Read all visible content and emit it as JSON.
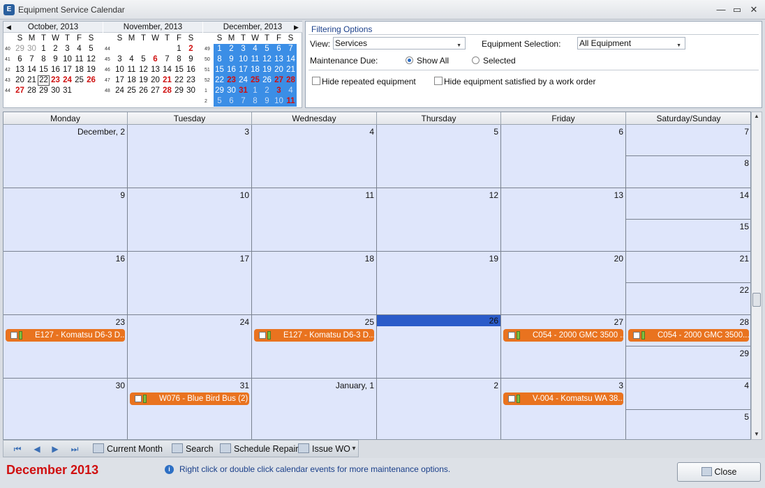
{
  "window": {
    "title": "Equipment Service Calendar",
    "min": "—",
    "max": "▭",
    "close": "✕"
  },
  "minical": {
    "nav_prev": "◀",
    "nav_next": "▶",
    "dow": [
      "S",
      "M",
      "T",
      "W",
      "T",
      "F",
      "S"
    ],
    "months": [
      {
        "title": "October, 2013",
        "weeks": [
          "40",
          "41",
          "42",
          "43",
          "44"
        ],
        "rows": [
          [
            "29g",
            "30g",
            "1",
            "2",
            "3",
            "4",
            "5"
          ],
          [
            "6",
            "7",
            "8",
            "9",
            "10",
            "11",
            "12"
          ],
          [
            "13",
            "14",
            "15",
            "16",
            "17",
            "18",
            "19"
          ],
          [
            "20",
            "21",
            "22t",
            "23r",
            "24r",
            "25",
            "26r"
          ],
          [
            "27r",
            "28",
            "29",
            "30",
            "31",
            "",
            ""
          ]
        ]
      },
      {
        "title": "November, 2013",
        "weeks": [
          "44",
          "45",
          "46",
          "47",
          "48"
        ],
        "rows": [
          [
            "",
            "",
            "",
            "",
            "",
            "1",
            "2r"
          ],
          [
            "3",
            "4",
            "5",
            "6r",
            "7",
            "8",
            "9"
          ],
          [
            "10",
            "11",
            "12",
            "13",
            "14",
            "15",
            "16"
          ],
          [
            "17",
            "18",
            "19",
            "20",
            "21r",
            "22",
            "23"
          ],
          [
            "24",
            "25",
            "26",
            "27",
            "28r",
            "29",
            "30"
          ]
        ]
      },
      {
        "title": "December, 2013",
        "weeks": [
          "49",
          "50",
          "51",
          "52",
          "1",
          "2"
        ],
        "rows": [
          [
            "1",
            "2",
            "3",
            "4",
            "5",
            "6",
            "7"
          ],
          [
            "8",
            "9",
            "10",
            "11",
            "12",
            "13",
            "14"
          ],
          [
            "15",
            "16",
            "17",
            "18",
            "19",
            "20",
            "21"
          ],
          [
            "22",
            "23r",
            "24",
            "25r",
            "26",
            "27r",
            "28r"
          ],
          [
            "29",
            "30",
            "31r",
            "1g",
            "2g",
            "3r",
            "4g"
          ],
          [
            "5g",
            "6g",
            "7g",
            "8g",
            "9g",
            "10g",
            "11r"
          ]
        ]
      }
    ]
  },
  "filter": {
    "title": "Filtering Options",
    "view_label": "View:",
    "view_value": "Services",
    "equip_label": "Equipment Selection:",
    "equip_value": "All Equipment",
    "maint_label": "Maintenance Due:",
    "show_all": "Show All",
    "selected": "Selected",
    "hide_repeated": "Hide repeated equipment",
    "hide_satisfied": "Hide equipment satisfied by a work order"
  },
  "calendar": {
    "headers": [
      "Monday",
      "Tuesday",
      "Wednesday",
      "Thursday",
      "Friday",
      "Saturday/Sunday"
    ],
    "weeks": [
      {
        "days": [
          "December, 2",
          "3",
          "4",
          "5",
          "6"
        ],
        "sat": "7",
        "sun": "8",
        "events": []
      },
      {
        "days": [
          "9",
          "10",
          "11",
          "12",
          "13"
        ],
        "sat": "14",
        "sun": "15",
        "events": []
      },
      {
        "days": [
          "16",
          "17",
          "18",
          "19",
          "20"
        ],
        "sat": "21",
        "sun": "22",
        "events": []
      },
      {
        "days": [
          "23",
          "24",
          "25",
          "26",
          "27"
        ],
        "sat": "28",
        "sun": "29",
        "today": 3,
        "events": [
          {
            "col": 0,
            "text": "E127 - Komatsu D6-3 D..."
          },
          {
            "col": 2,
            "text": "E127 - Komatsu D6-3 D..."
          },
          {
            "col": 4,
            "text": "C054 - 2000 GMC 3500 ..."
          },
          {
            "col": 5,
            "text": "C054 - 2000 GMC 3500..."
          }
        ]
      },
      {
        "days": [
          "30",
          "31",
          "January, 1",
          "2",
          "3"
        ],
        "sat": "4",
        "sun": "5",
        "events": [
          {
            "col": 1,
            "text": "W076 - Blue Bird Bus (2)"
          },
          {
            "col": 4,
            "text": "V-004 - Komatsu WA 38..."
          }
        ]
      }
    ]
  },
  "toolbar": {
    "first": "⏮",
    "prev": "◀",
    "next": "▶",
    "last": "⏭",
    "current_month": "Current Month",
    "search": "Search",
    "schedule_repair": "Schedule Repair",
    "issue_wo": "Issue WO",
    "more": "▾"
  },
  "status": {
    "month": "December 2013",
    "info": "Right click or double click calendar events for more maintenance options.",
    "close": "Close"
  }
}
